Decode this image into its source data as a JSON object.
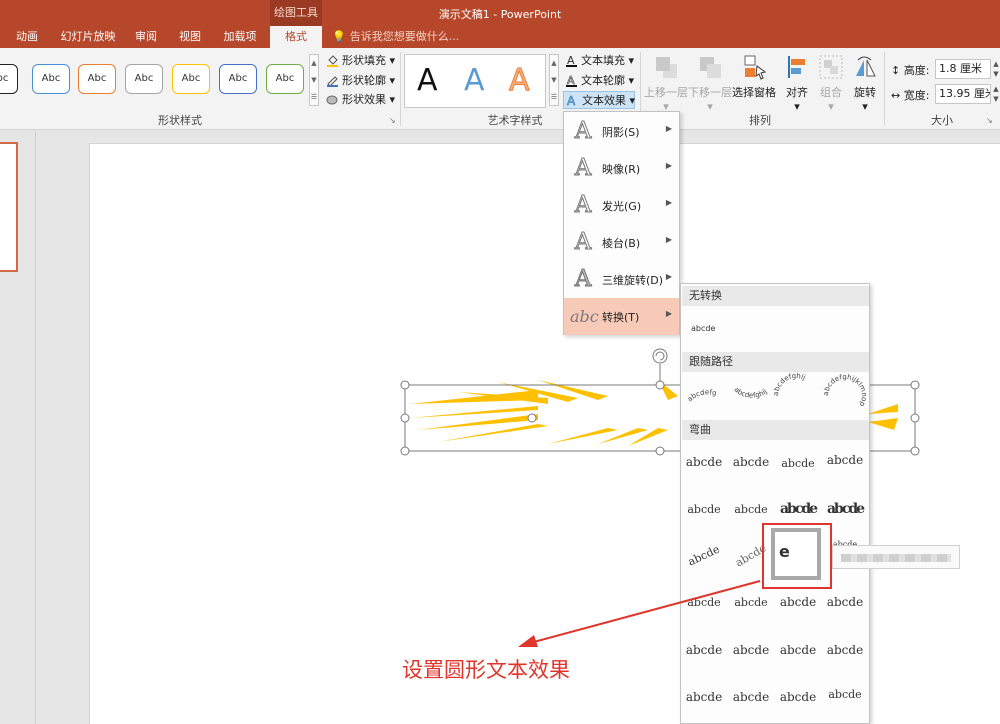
{
  "window": {
    "title": "演示文稿1 - PowerPoint",
    "contextual_tool": "绘图工具"
  },
  "tabs": [
    {
      "label": "动画",
      "active": false
    },
    {
      "label": "幻灯片放映",
      "active": false
    },
    {
      "label": "审阅",
      "active": false
    },
    {
      "label": "视图",
      "active": false
    },
    {
      "label": "加载项",
      "active": false
    },
    {
      "label": "格式",
      "active": true
    }
  ],
  "tell_me": {
    "placeholder": "告诉我您想要做什么..."
  },
  "ribbon": {
    "shape_styles": {
      "group_label": "形状样式",
      "sample_label": "Abc",
      "samples": [
        "#222222",
        "#4a90d9",
        "#ed7d31",
        "#a5a5a5",
        "#ffc000",
        "#4472c4",
        "#70ad47"
      ],
      "commands": {
        "fill": "形状填充",
        "outline": "形状轮廓",
        "effects": "形状效果"
      }
    },
    "wordart": {
      "group_label": "艺术字样式",
      "sample_glyph": "A",
      "commands": {
        "fill": "文本填充",
        "outline": "文本轮廓",
        "effects": "文本效果"
      }
    },
    "arrange": {
      "group_label": "排列",
      "commands": {
        "bring_forward": "上移一层",
        "send_backward": "下移一层",
        "selection_pane": "选择窗格",
        "align": "对齐",
        "group": "组合",
        "rotate": "旋转"
      }
    },
    "size": {
      "group_label": "大小",
      "height_label": "高度:",
      "height_value": "1.8 厘米",
      "width_label": "宽度:",
      "width_value": "13.95 厘米"
    }
  },
  "text_effects_menu": {
    "items": [
      {
        "label": "阴影(S)",
        "icon": "shadow-a-icon"
      },
      {
        "label": "映像(R)",
        "icon": "reflection-a-icon"
      },
      {
        "label": "发光(G)",
        "icon": "glow-a-icon"
      },
      {
        "label": "棱台(B)",
        "icon": "bevel-a-icon"
      },
      {
        "label": "三维旋转(D)",
        "icon": "rotation-3d-a-icon"
      },
      {
        "label": "转换(T)",
        "icon": "transform-abc-icon",
        "active": true
      }
    ]
  },
  "transform_menu": {
    "header_none": "无转换",
    "no_transform_sample": "abcde",
    "header_follow_path": "跟随路径",
    "follow_path_samples": [
      "abcdefg",
      "abcdefghij",
      "abcdefghij",
      "abcdefghijklmnop"
    ],
    "header_warp": "弯曲",
    "warp_sample": "abcde"
  },
  "annotation": {
    "text": "设置圆形文本效果",
    "color": "#e0352b"
  },
  "colors": {
    "accent": "#b7472a",
    "selection": "#f8cbb8",
    "shape_fill": "#ffc000"
  }
}
